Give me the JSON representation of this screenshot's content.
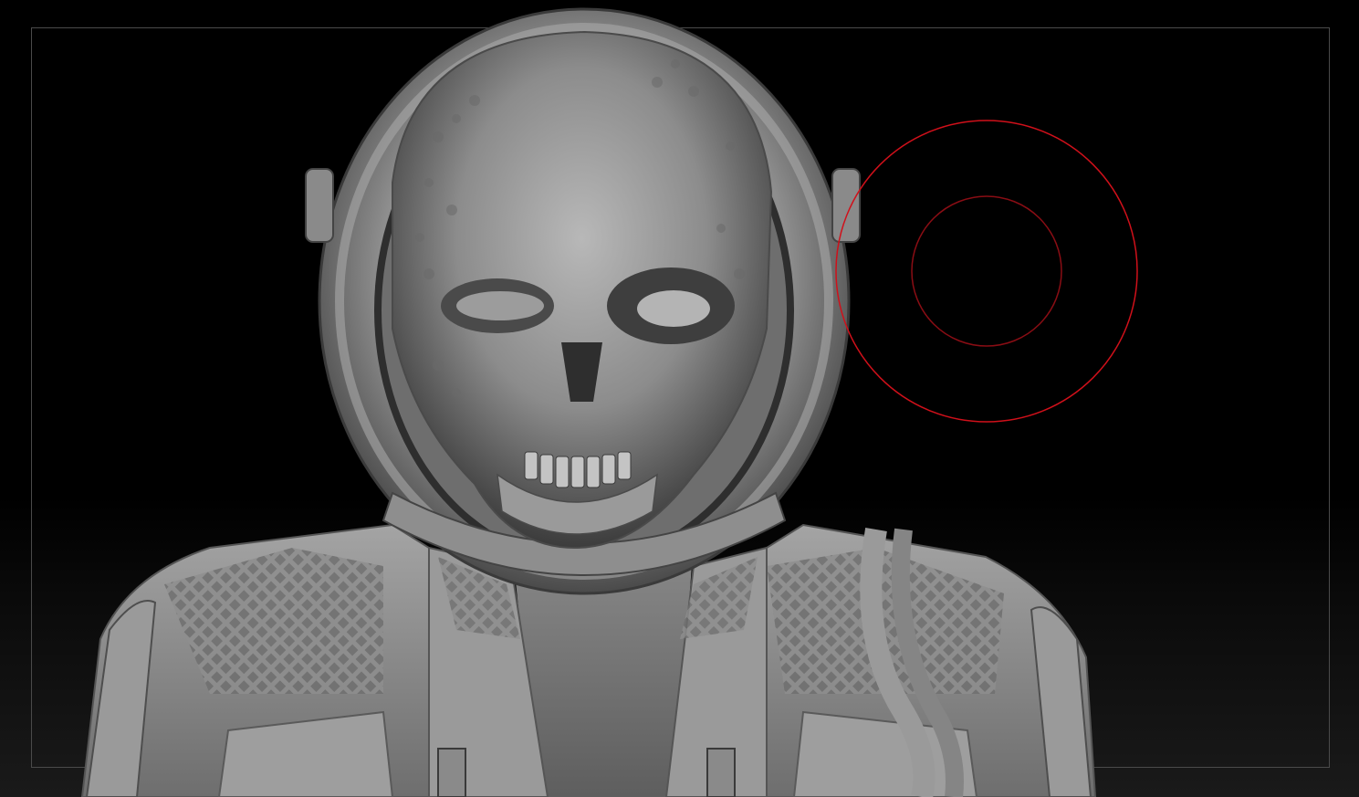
{
  "app": {
    "viewport_label": ""
  },
  "scene": {
    "subject": "sculpt-model",
    "background_color": "#000000",
    "floor_gradient_color": "#1a1a1a",
    "frame_color": "#4a4a4a"
  },
  "brush": {
    "outer_ring_color": "#d0101a",
    "inner_ring_color": "#8a0d14"
  }
}
